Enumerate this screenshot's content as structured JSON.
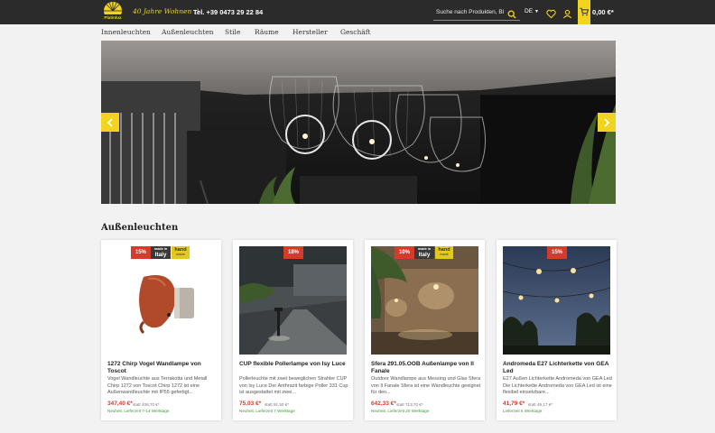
{
  "header": {
    "logo_text": "Platinlux",
    "slogan": "40 Jahre Wohnen :)",
    "phone": "Tel. +39 0473 29 22 84",
    "search_placeholder": "Suche nach Produkten, Bl",
    "language": "DE",
    "cart_total": "0,00 €*"
  },
  "nav": {
    "items": [
      "Innenleuchten",
      "Außenleuchten",
      "Stile",
      "Räume",
      "Hersteller",
      "Geschäft"
    ]
  },
  "section": {
    "title": "Außenleuchten"
  },
  "products": [
    {
      "discount": "15%",
      "made_in_italy": true,
      "handmade": true,
      "title": "1272 Chirp Vogel Wandlampe von Toscot",
      "description": "Vogel Wandleuchte aus Terrakotta und Metall Chirp 1272 von Toscot Chirp 1272 ist eine Außenwandleuchte mit IP55 gefertigt...",
      "price": "347,40 €*",
      "old_price": "statt 408,70 €*",
      "delivery": "Neuheit. Lieferzeit 7-14 Werktage"
    },
    {
      "discount": "18%",
      "made_in_italy": false,
      "handmade": false,
      "title": "CUP flexible Pollerlampe von Isy Luce",
      "description": "Pollerleuchte mit zwei beweglichen Strahler CUP von Isy Luce Der Anthrazit farbige Poller 331 Cup ist ausgestattet mit zwei...",
      "price": "75,03 €*",
      "old_price": "statt 91,50 €*",
      "delivery": "Neuheit. Lieferzeit 7 Werktage"
    },
    {
      "discount": "10%",
      "made_in_italy": true,
      "handmade": true,
      "title": "Sfera 291.05.OOB Außenlampe von Il Fanale",
      "description": "Outdoor Wandlampe aus Messing und Glas Sfera von Il Fanale Sfera ist eine Wandleuchte geeignet für den...",
      "price": "642,33 €*",
      "old_price": "statt 713,70 €*",
      "delivery": "Neuheit. Lieferzeit 20 Werktage"
    },
    {
      "discount": "15%",
      "made_in_italy": false,
      "handmade": false,
      "title": "Andromeda E27 Lichterkette von GEA Led",
      "description": "E27 Außen Lichterkette Andromeda von GEA Led Die Lichterkette Andromeda von GEA Led ist eine flexibel einsetzbare...",
      "price": "41,79 €*",
      "old_price": "statt 49,17 €*",
      "delivery": "Lieferzeit 6 Werktage"
    }
  ],
  "badges": {
    "made_line1": "made in",
    "made_line2": "Italy",
    "hand_line1": "hand",
    "hand_line2": "made"
  },
  "colors": {
    "header_bg": "#2b2b2b",
    "accent_yellow": "#f2d41f",
    "discount_red": "#d63a2b",
    "delivery_green": "#3a9a36"
  }
}
